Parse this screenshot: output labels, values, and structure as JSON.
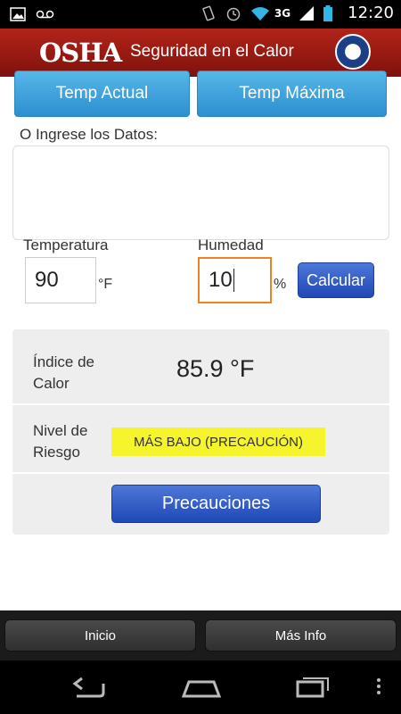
{
  "status_bar": {
    "time": "12:20",
    "network": "3G",
    "icons": [
      "image-icon",
      "voicemail-icon",
      "vibrate-icon",
      "alarm-icon",
      "wifi-icon",
      "signal-icon",
      "battery-icon"
    ]
  },
  "header": {
    "logo_text": "OSHA",
    "title": "Seguridad en el Calor",
    "seal_icon": "dol-seal-icon"
  },
  "main": {
    "temp_actual_label": "Temp Actual",
    "temp_maxima_label": "Temp Máxima",
    "ingrese_label": "O Ingrese los Datos:",
    "temperatura_label": "Temperatura",
    "temperatura_value": "90",
    "temperatura_unit": "°F",
    "humedad_label": "Humedad",
    "humedad_value": "10",
    "humedad_unit": "%",
    "calcular_label": "Calcular",
    "indice_label": "Índice de Calor",
    "indice_value": "85.9 °F",
    "nivel_label": "Nivel de Riesgo",
    "nivel_value": "MÁS BAJO (PRECAUCIÓN)",
    "precauciones_label": "Precauciones"
  },
  "tabs": {
    "inicio": "Inicio",
    "mas_info": "Más Info"
  },
  "colors": {
    "header_red": "#9e1b14",
    "blue_button": "#2d8fd0",
    "dark_blue_button": "#1f49b5",
    "risk_yellow": "#f6f42c",
    "focus_orange": "#f0821f"
  }
}
